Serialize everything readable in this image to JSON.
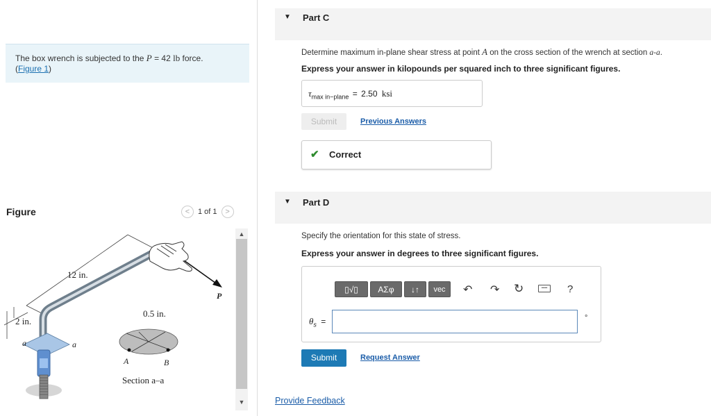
{
  "problem": {
    "text_before": "The box wrench is subjected to the ",
    "var_P": "P",
    "equals": " = 42 ",
    "unit": "lb",
    "text_after": " force.",
    "figure_link": "Figure 1",
    "link_open": "(",
    "link_close": ")"
  },
  "figure_panel": {
    "title": "Figure",
    "pager": "1 of 1",
    "labels": {
      "twelve_in": "12 in.",
      "two_in": "2 in.",
      "half_in": "0.5 in.",
      "P": "P",
      "a_left": "a",
      "a_right": "a",
      "A": "A",
      "B": "B",
      "section": "Section a–a"
    }
  },
  "part_c": {
    "title": "Part C",
    "question": "Determine maximum in-plane shear stress at point ",
    "point": "A",
    "question_mid": " on the cross section of the wrench at section ",
    "section": "a-a",
    "question_end": ".",
    "instruction": "Express your answer in kilopounds per squared inch to three significant figures.",
    "answer_symbol": "τ",
    "answer_subscript": "max in−plane",
    "answer_eq": "=",
    "answer_value": "2.50",
    "answer_unit": "ksi",
    "submit_label": "Submit",
    "previous_answers": "Previous Answers",
    "feedback": "Correct",
    "check_color": "#2e8b2e"
  },
  "part_d": {
    "title": "Part D",
    "question": "Specify the orientation for this state of stress.",
    "instruction": "Express your answer in degrees to three significant figures.",
    "toolbar": {
      "templates": "▯√▯",
      "symbols": "ΑΣφ",
      "arrows": "↓↑",
      "vec": "vec",
      "help": "?"
    },
    "input_symbol": "θ",
    "input_subscript": "s",
    "input_eq": "=",
    "input_value": "",
    "unit": "°",
    "submit_label": "Submit",
    "request_answer": "Request Answer"
  },
  "footer": {
    "provide_feedback": "Provide Feedback"
  }
}
